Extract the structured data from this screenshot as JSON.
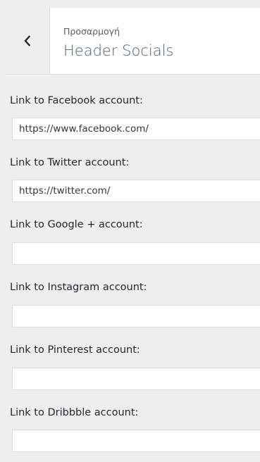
{
  "header": {
    "breadcrumb": "Προσαρμογή",
    "title": "Header Socials"
  },
  "fields": [
    {
      "label": "Link to Facebook account:",
      "value": "https://www.facebook.com/"
    },
    {
      "label": "Link to Twitter account:",
      "value": "https://twitter.com/"
    },
    {
      "label": "Link to Google + account:",
      "value": ""
    },
    {
      "label": "Link to Instagram account:",
      "value": ""
    },
    {
      "label": "Link to Pinterest account:",
      "value": ""
    },
    {
      "label": "Link to Dribbble account:",
      "value": ""
    }
  ]
}
